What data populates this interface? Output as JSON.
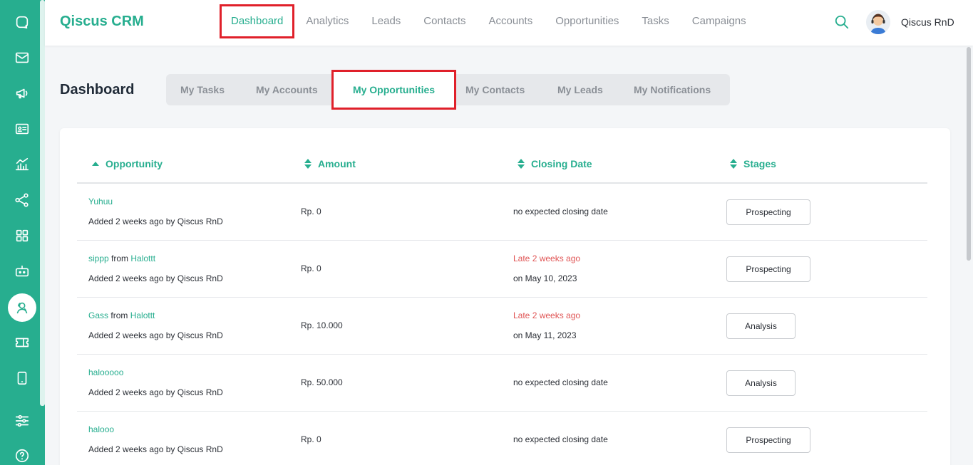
{
  "app": {
    "brand": "Qiscus CRM"
  },
  "nav": [
    {
      "label": "Dashboard",
      "active": true
    },
    {
      "label": "Analytics"
    },
    {
      "label": "Leads"
    },
    {
      "label": "Contacts"
    },
    {
      "label": "Accounts"
    },
    {
      "label": "Opportunities"
    },
    {
      "label": "Tasks"
    },
    {
      "label": "Campaigns"
    }
  ],
  "user": {
    "name": "Qiscus RnD"
  },
  "rail_icons": [
    "chat-icon",
    "mail-icon",
    "megaphone-icon",
    "contact-card-icon",
    "chart-icon",
    "share-nodes-icon",
    "apps-grid-icon",
    "bot-icon",
    "crm-user-icon",
    "ticket-icon",
    "mobile-icon",
    "settings-sliders-icon",
    "help-icon"
  ],
  "page": {
    "title": "Dashboard"
  },
  "tabs": [
    {
      "label": "My Tasks"
    },
    {
      "label": "My Accounts"
    },
    {
      "label": "My Opportunities",
      "active": true
    },
    {
      "label": "My Contacts"
    },
    {
      "label": "My Leads"
    },
    {
      "label": "My Notifications"
    }
  ],
  "table": {
    "headers": {
      "opportunity": "Opportunity",
      "amount": "Amount",
      "closing": "Closing Date",
      "stages": "Stages"
    },
    "rows": [
      {
        "name": "Yuhuu",
        "from_word": "",
        "company": "",
        "added": "Added 2 weeks ago by Qiscus RnD",
        "amount": "Rp. 0",
        "late": "",
        "closing": "no expected closing date",
        "stage": "Prospecting"
      },
      {
        "name": "sippp",
        "from_word": "from",
        "company": "Halottt",
        "added": "Added 2 weeks ago by Qiscus RnD",
        "amount": "Rp. 0",
        "late": "Late 2 weeks ago",
        "closing": "on May 10, 2023",
        "stage": "Prospecting"
      },
      {
        "name": "Gass",
        "from_word": "from",
        "company": "Halottt",
        "added": "Added 2 weeks ago by Qiscus RnD",
        "amount": "Rp. 10.000",
        "late": "Late 2 weeks ago",
        "closing": "on May 11, 2023",
        "stage": "Analysis"
      },
      {
        "name": "halooooo",
        "from_word": "",
        "company": "",
        "added": "Added 2 weeks ago by Qiscus RnD",
        "amount": "Rp. 50.000",
        "late": "",
        "closing": "no expected closing date",
        "stage": "Analysis"
      },
      {
        "name": "halooo",
        "from_word": "",
        "company": "",
        "added": "Added 2 weeks ago by Qiscus RnD",
        "amount": "Rp. 0",
        "late": "",
        "closing": "no expected closing date",
        "stage": "Prospecting"
      }
    ]
  },
  "colors": {
    "accent": "#27ae8f",
    "highlight": "#e0202a",
    "late": "#e05555"
  }
}
